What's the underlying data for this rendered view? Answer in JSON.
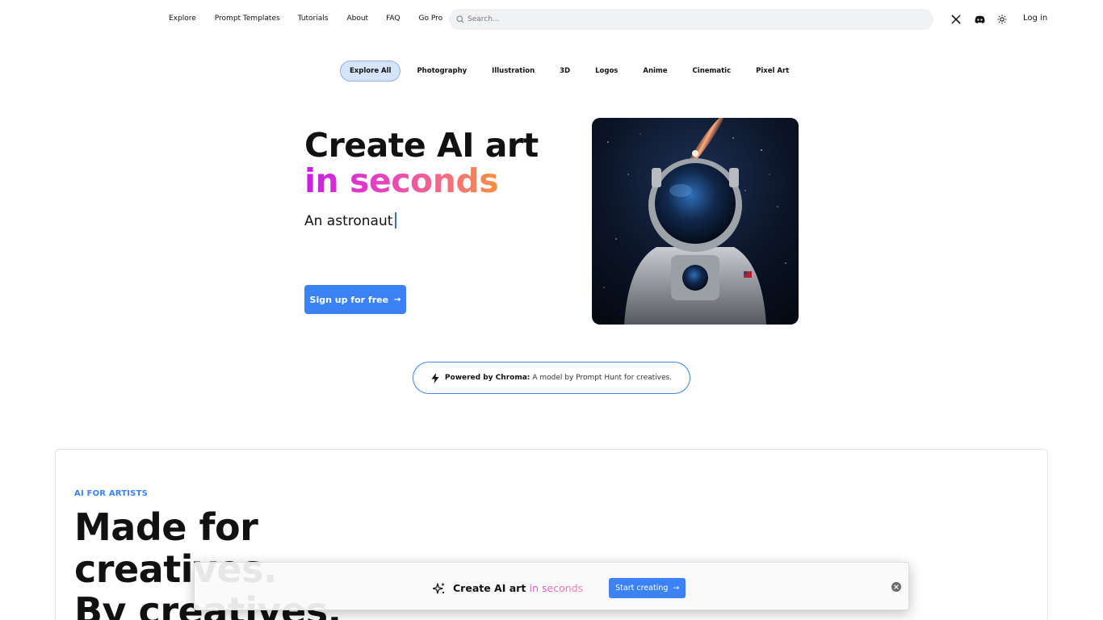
{
  "nav": {
    "links": [
      "Explore",
      "Prompt Templates",
      "Tutorials",
      "About",
      "FAQ",
      "Go Pro"
    ],
    "search_placeholder": "Search...",
    "icons": [
      "x-twitter-icon",
      "discord-icon",
      "theme-sun-icon"
    ],
    "login_label": "Log in"
  },
  "categories": [
    "Explore All",
    "Photography",
    "Illustration",
    "3D",
    "Logos",
    "Anime",
    "Cinematic",
    "Pixel Art"
  ],
  "active_category": "Explore All",
  "hero": {
    "title_line1": "Create AI art",
    "title_line2": "in seconds",
    "typing_text": "An astronaut",
    "signup_label": "Sign up for free",
    "image_subject": "astronaut-in-space"
  },
  "powered": {
    "bold": "Powered by Chroma:",
    "rest": "A model by Prompt Hunt for creatives."
  },
  "section": {
    "eyebrow": "AI FOR ARTISTS",
    "heading_line1": "Made for",
    "heading_line2": "creatives.",
    "heading_line3": "By creatives."
  },
  "float_bar": {
    "text_main": "Create AI art",
    "text_grad": "in seconds",
    "button_label": "Start creating"
  },
  "colors": {
    "accent": "#3b82f6",
    "gradient_start": "#c81ee6",
    "gradient_end": "#f7913e"
  }
}
